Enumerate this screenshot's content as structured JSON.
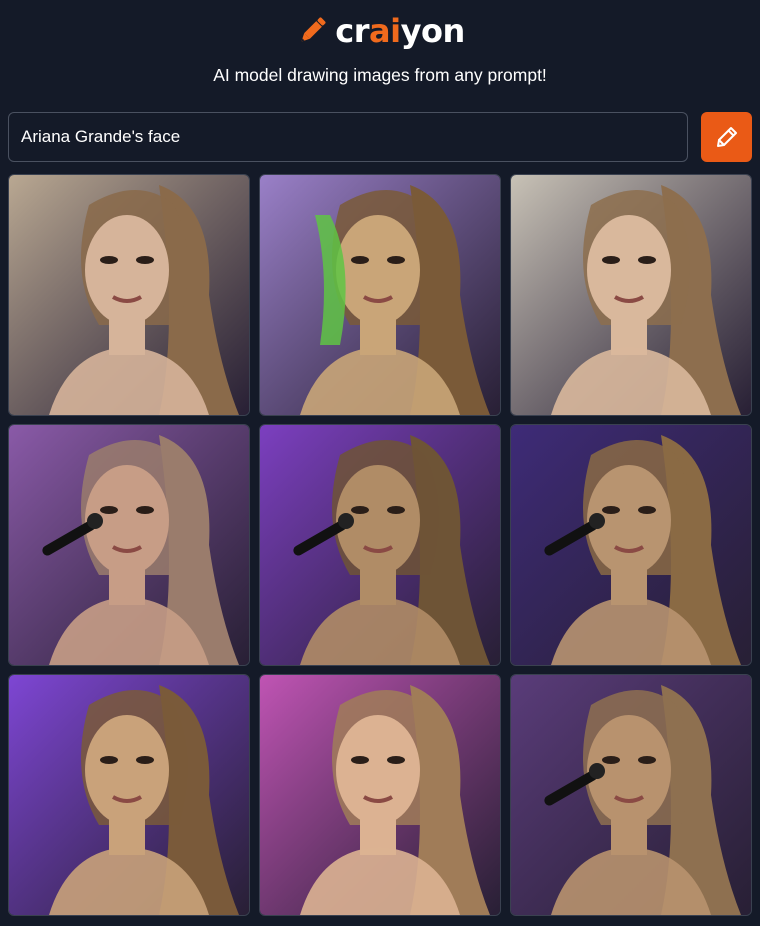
{
  "header": {
    "logo_icon": "pencil-icon",
    "brand_prefix": "cr",
    "brand_accent": "ai",
    "brand_suffix": "yon",
    "tagline": "AI model drawing images from any prompt!"
  },
  "search": {
    "value": "Ariana Grande's face",
    "button_icon": "pencil-icon"
  },
  "colors": {
    "background": "#141a28",
    "accent": "#ea5a16",
    "text": "#ffffff"
  },
  "results": [
    {
      "bg": "#b9a892",
      "hair": "#8a6a4a",
      "skin": "#d6b49a",
      "extra": "none"
    },
    {
      "bg": "#9a80c8",
      "hair": "#7a5a38",
      "skin": "#c9a578",
      "extra": "green"
    },
    {
      "bg": "#c8c2b6",
      "hair": "#8d6e4e",
      "skin": "#d9b89c",
      "extra": "none"
    },
    {
      "bg": "#8a5aa8",
      "hair": "#9a7c6c",
      "skin": "#c79d86",
      "extra": "mic"
    },
    {
      "bg": "#7c3fc0",
      "hair": "#6e5436",
      "skin": "#b08c66",
      "extra": "mic"
    },
    {
      "bg": "#3e2b78",
      "hair": "#8a6a44",
      "skin": "#b89470",
      "extra": "mic"
    },
    {
      "bg": "#7e46d4",
      "hair": "#7a5a3a",
      "skin": "#c9a27a",
      "extra": "none"
    },
    {
      "bg": "#c054b4",
      "hair": "#a07c58",
      "skin": "#dcb292",
      "extra": "none"
    },
    {
      "bg": "#5a3c7a",
      "hair": "#8e7050",
      "skin": "#b8926e",
      "extra": "mic"
    }
  ]
}
